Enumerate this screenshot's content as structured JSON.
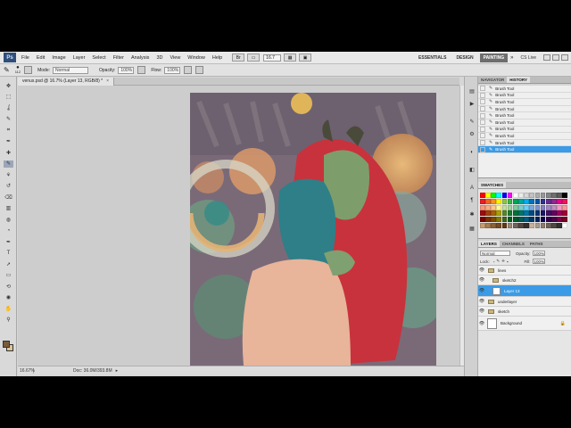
{
  "menubar": {
    "logo": "Ps",
    "items": [
      "File",
      "Edit",
      "Image",
      "Layer",
      "Select",
      "Filter",
      "Analysis",
      "3D",
      "View",
      "Window",
      "Help"
    ],
    "zoom": "16.7",
    "workspaces": [
      "ESSENTIALS",
      "DESIGN",
      "PAINTING"
    ],
    "active_workspace": "PAINTING",
    "more": "»",
    "cs_live": "CS Live"
  },
  "options": {
    "brush_size": "112",
    "mode_label": "Mode:",
    "mode_value": "Normal",
    "opacity_label": "Opacity:",
    "opacity_value": "100%",
    "flow_label": "Flow:",
    "flow_value": "100%"
  },
  "document": {
    "tab_title": "venus.psd @ 16.7% (Layer 13, RGB/8) *",
    "close": "×"
  },
  "status": {
    "zoom": "16.67%",
    "doc_info": "Doc: 36.0M/393.8M",
    "arrow": "▸"
  },
  "history": {
    "tabs": [
      "NAVIGATOR",
      "HISTORY"
    ],
    "active_tab": "HISTORY",
    "items": [
      "Brush Tool",
      "Brush Tool",
      "Brush Tool",
      "Brush Tool",
      "Brush Tool",
      "Brush Tool",
      "Brush Tool",
      "Brush Tool",
      "Brush Tool",
      "Brush Tool"
    ],
    "selected_index": 9
  },
  "swatches": {
    "tabs": [
      "SWATCHES"
    ],
    "colors": [
      "#ff0000",
      "#ffff00",
      "#00ff00",
      "#00ffff",
      "#0000ff",
      "#ff00ff",
      "#ffffff",
      "#ebebeb",
      "#d6d6d6",
      "#c2c2c2",
      "#adadad",
      "#999999",
      "#858585",
      "#707070",
      "#5c5c5c",
      "#000000",
      "#ee1d24",
      "#f26522",
      "#f7941d",
      "#fff200",
      "#8dc63f",
      "#39b54a",
      "#00a651",
      "#00a99d",
      "#00aeef",
      "#0072bc",
      "#0054a6",
      "#2e3192",
      "#662d91",
      "#92278f",
      "#ec008c",
      "#ed145b",
      "#f7977a",
      "#f9ad81",
      "#fdc68a",
      "#fff79a",
      "#c4df9b",
      "#a3d39c",
      "#82ca9d",
      "#7bcdc8",
      "#6dcff6",
      "#7da7d9",
      "#8393ca",
      "#8781bd",
      "#a187be",
      "#bc8dbf",
      "#f49ac2",
      "#f6989d",
      "#9e0b0f",
      "#a0410d",
      "#a3620a",
      "#aba000",
      "#598527",
      "#1a7b30",
      "#007236",
      "#00746b",
      "#0076a3",
      "#004a80",
      "#003471",
      "#1b1464",
      "#440e62",
      "#630460",
      "#9e005d",
      "#9e0039",
      "#790000",
      "#7b2e00",
      "#7d4900",
      "#827b00",
      "#406618",
      "#005e20",
      "#005826",
      "#005952",
      "#005b7f",
      "#003663",
      "#002157",
      "#0d004c",
      "#32004b",
      "#4b0049",
      "#7b0046",
      "#7a0026",
      "#c69c6d",
      "#a67c52",
      "#8c6239",
      "#754c24",
      "#603913",
      "#998675",
      "#736357",
      "#534741",
      "#362f2d",
      "#c7b299",
      "#a99b8a",
      "#8c7d70",
      "#6e6259",
      "#504843",
      "#34302c",
      "#ffffff"
    ]
  },
  "layers": {
    "tabs": [
      "LAYERS",
      "CHANNELS",
      "PATHS"
    ],
    "active_tab": "LAYERS",
    "blend_mode": "Normal",
    "opacity_label": "Opacity:",
    "opacity_value": "100%",
    "lock_label": "Lock:",
    "fill_label": "Fill:",
    "fill_value": "100%",
    "items": [
      {
        "name": "lines",
        "type": "folder",
        "indent": false
      },
      {
        "name": "sketch2",
        "type": "folder",
        "indent": true
      },
      {
        "name": "Layer 13",
        "type": "layer",
        "indent": true
      },
      {
        "name": "underlayer",
        "type": "folder",
        "indent": false
      },
      {
        "name": "sketch",
        "type": "folder",
        "indent": false
      },
      {
        "name": "Background",
        "type": "background",
        "indent": false
      }
    ],
    "selected_index": 2,
    "lock_icon": "🔒"
  },
  "colors": {
    "selection": "#3b9be6",
    "active_workspace": "#6e6e6e"
  },
  "icons": {
    "tools": [
      "move-icon",
      "marquee-icon",
      "lasso-icon",
      "quick-select-icon",
      "crop-icon",
      "eyedropper-icon",
      "healing-icon",
      "brush-icon",
      "clone-stamp-icon",
      "history-brush-icon",
      "eraser-icon",
      "gradient-icon",
      "blur-icon",
      "dodge-icon",
      "pen-icon",
      "type-icon",
      "path-select-icon",
      "shape-icon",
      "3d-rotate-icon",
      "3d-orbit-icon",
      "hand-icon",
      "zoom-icon"
    ]
  }
}
